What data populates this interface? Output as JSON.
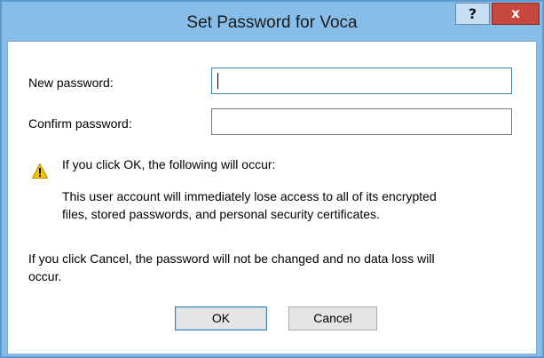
{
  "window": {
    "title": "Set Password for Voca",
    "help_glyph": "?",
    "close_glyph": "x"
  },
  "form": {
    "new_password_label": "New password:",
    "new_password_value": "",
    "confirm_password_label": "Confirm password:",
    "confirm_password_value": ""
  },
  "warning": {
    "icon": "warning-icon",
    "heading": "If you click OK, the following will occur:",
    "detail_line1": "This user account will immediately lose access to all of its encrypted",
    "detail_line2": "files, stored passwords, and personal security certificates."
  },
  "cancel_note": {
    "line1": "If you click Cancel, the password will not be changed and no data loss will",
    "line2": "occur."
  },
  "buttons": {
    "ok_label": "OK",
    "cancel_label": "Cancel"
  },
  "colors": {
    "frame": "#87bde9",
    "close_button": "#c7463d",
    "warning_yellow": "#f5c400"
  }
}
